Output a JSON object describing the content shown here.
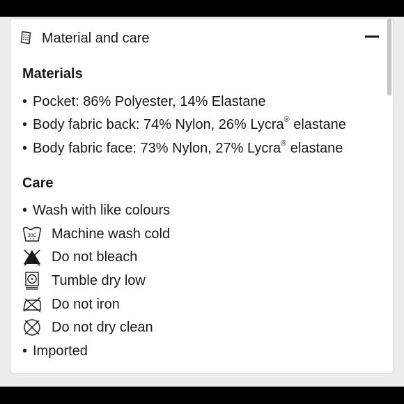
{
  "header": {
    "title": "Material and care",
    "icon": "fabric-tag-icon",
    "collapse_icon": "minus-icon"
  },
  "materials": {
    "title": "Materials",
    "items": [
      {
        "text": "Pocket: 86% Polyester, 14% Elastane"
      },
      {
        "text": "Body fabric back: 74% Nylon, 26% Lycra",
        "sup": "®",
        "after": " elastane"
      },
      {
        "text": "Body fabric face: 73% Nylon, 27% Lycra",
        "sup": "®",
        "after": " elastane"
      }
    ]
  },
  "care": {
    "title": "Care",
    "bullet1": "Wash with like colours",
    "machine_wash": {
      "label": "Machine wash cold",
      "icon": "wash-30c-icon",
      "icon_text": "30C"
    },
    "no_bleach": {
      "label": "Do not bleach",
      "icon": "do-not-bleach-icon"
    },
    "tumble_dry": {
      "label": "Tumble dry low",
      "icon": "tumble-dry-low-icon"
    },
    "no_iron": {
      "label": "Do not iron",
      "icon": "do-not-iron-icon"
    },
    "no_dry_clean": {
      "label": "Do not dry clean",
      "icon": "do-not-dry-clean-icon"
    },
    "bullet2": "Imported"
  },
  "bullet_char": "•"
}
